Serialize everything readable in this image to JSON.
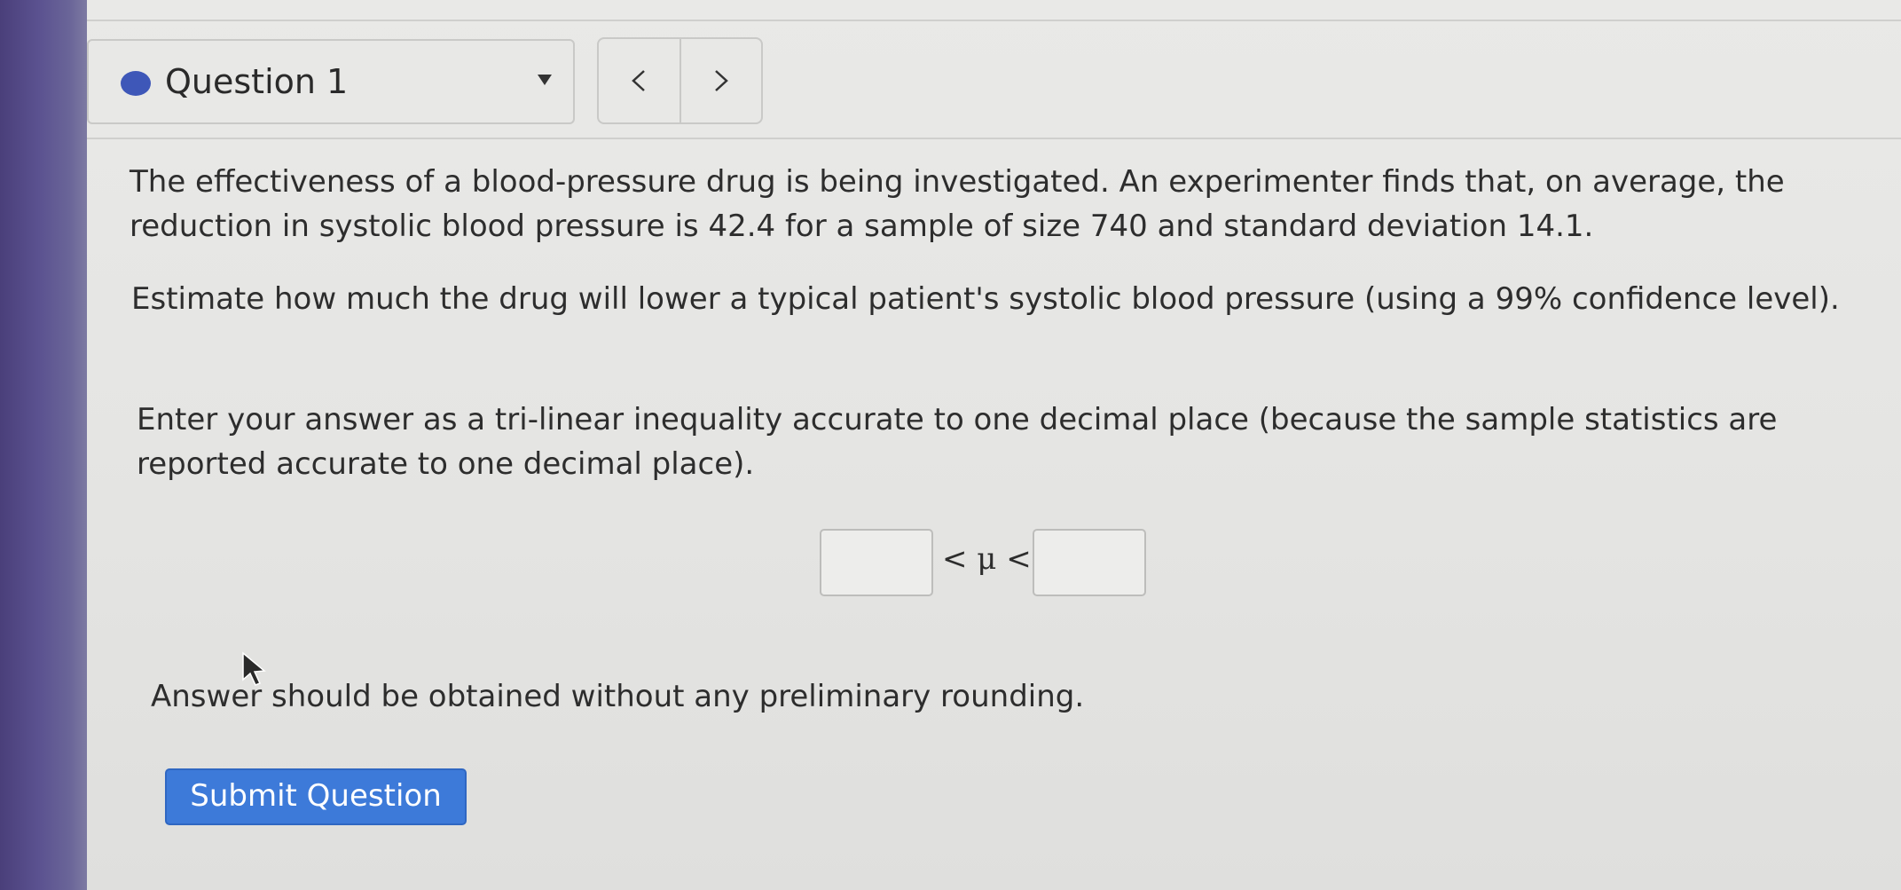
{
  "question_selector": {
    "label": "Question 1",
    "status_color": "#3e57b8",
    "icon": "chevron-down-icon"
  },
  "nav": {
    "prev_icon": "chevron-left-icon",
    "next_icon": "chevron-right-icon"
  },
  "problem": {
    "paragraph1": "The effectiveness of a blood-pressure drug is being investigated. An experimenter finds that, on average, the reduction in systolic blood pressure is 42.4 for a sample of size 740 and standard deviation 14.1.",
    "paragraph2": "Estimate how much the drug will lower a typical patient's systolic blood pressure (using a 99% confidence level).",
    "paragraph3": "Enter your answer as a tri-linear inequality accurate to one decimal place (because the sample statistics are reported accurate to one decimal place)."
  },
  "answer": {
    "lower_value": "",
    "upper_value": "",
    "inequality_symbol": "< μ <"
  },
  "hint": "Answer should be obtained without any preliminary rounding.",
  "submit_label": "Submit Question",
  "colors": {
    "submit_bg": "#3d7ad9",
    "bezel": "#5b5290"
  }
}
